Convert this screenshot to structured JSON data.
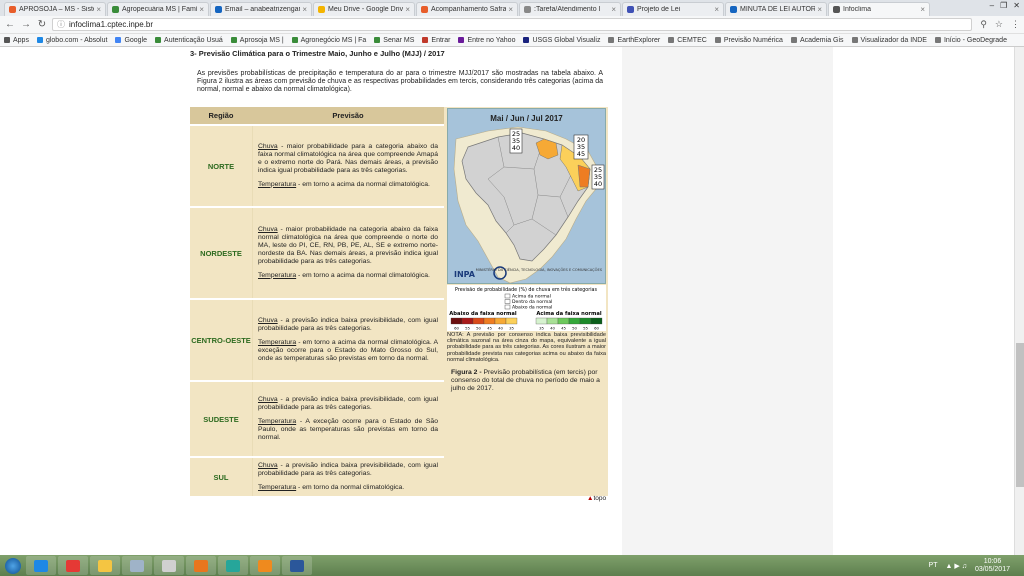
{
  "browser": {
    "tabs": [
      {
        "title": "APROSOJA – MS - Sistem",
        "color": "#e85d2a"
      },
      {
        "title": "Agropecuária MS | Famí",
        "color": "#3a8c3a"
      },
      {
        "title": "Email – anabeatrizengar",
        "color": "#1565c0"
      },
      {
        "title": "Meu Drive - Google Driv",
        "color": "#f4b400"
      },
      {
        "title": "Acompanhamento Safra",
        "color": "#e85d2a"
      },
      {
        "title": ":Tarefa/Atendimento I",
        "color": "#888888"
      },
      {
        "title": "Projeto de Lei",
        "color": "#3f51b5"
      },
      {
        "title": "MINUTA DE LEI AUTORIZ",
        "color": "#1565c0"
      },
      {
        "title": "Infoclima",
        "color": "#555555"
      }
    ],
    "url": "infoclima1.cptec.inpe.br",
    "bookmarks": [
      {
        "label": "Apps",
        "color": "#555555"
      },
      {
        "label": "globo.com - Absolut",
        "color": "#1e88e5"
      },
      {
        "label": "Google",
        "color": "#4285f4"
      },
      {
        "label": "Autenticação Usuá",
        "color": "#3a8c3a"
      },
      {
        "label": "Aprosoja MS |",
        "color": "#3a8c3a"
      },
      {
        "label": "Agronegócio MS | Fa",
        "color": "#3a8c3a"
      },
      {
        "label": "Senar MS",
        "color": "#3a8c3a"
      },
      {
        "label": "Entrar",
        "color": "#c0392b"
      },
      {
        "label": "Entre no Yahoo",
        "color": "#6a1b9a"
      },
      {
        "label": "USGS Global Visualiz",
        "color": "#1a237e"
      },
      {
        "label": "EarthExplorer",
        "color": "#777777"
      },
      {
        "label": "CEMTEC",
        "color": "#777777"
      },
      {
        "label": "Previsão Numérica",
        "color": "#777777"
      },
      {
        "label": "Academia Gis",
        "color": "#777777"
      },
      {
        "label": "Visualizador da INDE",
        "color": "#777777"
      },
      {
        "label": "Início - GeoDegrade",
        "color": "#777777"
      }
    ]
  },
  "page": {
    "section_title": "3- Previsão Climática para o Trimestre Maio, Junho e Julho (MJJ)  / 2017",
    "intro": "As previsões probabilísticas de precipitação e temperatura do ar para o trimestre MJJ/2017 são mostradas na tabela abaixo. A Figura 2 ilustra as áreas com previsão de chuva e as respectivas probabilidades em tercis, considerando três categorias (acima da normal, normal e abaixo da normal climatológica).",
    "col_region": "Região",
    "col_forecast": "Previsão",
    "rows": [
      {
        "region": "NORTE",
        "rain_label": "Chuva",
        "rain_text": " - maior probabilidade para a categoria abaixo da faixa normal climatológica na área que compreende Amapá e o extremo norte do Pará. Nas demais áreas, a previsão indica igual probabilidade para as três categorias.",
        "temp_label": "Temperatura",
        "temp_text": " - em torno a acima da normal climatológica."
      },
      {
        "region": "NORDESTE",
        "rain_label": "Chuva",
        "rain_text": " - maior probabilidade na categoria abaixo da faixa normal climatológica na área que compreende o norte do MA, leste do PI, CE, RN, PB, PE, AL, SE e extremo norte-nordeste da BA. Nas demais áreas, a previsão indica igual probabilidade para as três categorias.",
        "temp_label": "Temperatura",
        "temp_text": " - em torno a acima da normal climatológica."
      },
      {
        "region": "CENTRO-OESTE",
        "rain_label": "Chuva",
        "rain_text": " - a previsão indica baixa previsibilidade, com igual probabilidade para as três categorias.",
        "temp_label": "Temperatura",
        "temp_text": " - em torno a acima da normal climatológica. A exceção ocorre para o Estado do Mato Grosso do Sul, onde as temperaturas são previstas em torno da normal."
      },
      {
        "region": "SUDESTE",
        "rain_label": "Chuva",
        "rain_text": " - a previsão indica baixa previsibilidade, com igual probabilidade para as três categorias.",
        "temp_label": "Temperatura",
        "temp_text": " - A exceção ocorre para o Estado de São Paulo, onde as temperaturas são previstas em torno da normal."
      },
      {
        "region": "SUL",
        "rain_label": "Chuva",
        "rain_text": " - a previsão indica baixa previsibilidade, com igual probabilidade para as três categorias.",
        "temp_label": "Temperatura",
        "temp_text": " - em torno da normal climatológica."
      }
    ],
    "figure": {
      "map_title": "Mai / Jun / Jul 2017",
      "box_north": [
        "25",
        "35",
        "40"
      ],
      "box_ne_top": [
        "20",
        "35",
        "45"
      ],
      "box_ne_mid": [
        "25",
        "35",
        "40"
      ],
      "inpa_logo": "INPA",
      "ministry": "MINISTÉRIO DA CIÊNCIA, TECNOLOGIA, INOVAÇÕES E COMUNICAÇÕES",
      "legend_title": "Previsão de probabilidade (%) de chuva em três categorias",
      "legend_items": [
        "Acima da normal",
        "Dentro da normal",
        "Abaixo da normal"
      ],
      "below_label": "Abaixo da faixa normal",
      "above_label": "Acima da faixa normal",
      "below_colors": [
        "#6b0f0f",
        "#a81a1a",
        "#d94a1a",
        "#ee7d22",
        "#f6a935",
        "#fbd05a"
      ],
      "above_colors": [
        "#d6f2cf",
        "#a8e096",
        "#6cc85c",
        "#34a83a",
        "#1c8a2a",
        "#0b5e1a"
      ],
      "scale_below": [
        "60",
        "55",
        "50",
        "45",
        "40",
        "35"
      ],
      "scale_above": [
        "35",
        "40",
        "45",
        "50",
        "55",
        "60"
      ],
      "note": "NOTA: A previsão por consenso indica baixa previsibilidade climática sazonal na área cinza do mapa, equivalente a igual probabilidade para as três categorias. As cores ilustram a maior probabilidade prevista nas categorias acima ou abaixo da faixa normal climatológica.",
      "caption_bold": "Figura 2 -",
      "caption_text": " Previsão probabilística (em tercis) por consenso do total de chuva no período de maio a julho de 2017."
    },
    "top_link": "topo"
  },
  "taskbar": {
    "apps": [
      {
        "name": "internet-explorer",
        "color": "#1e88e5"
      },
      {
        "name": "chrome",
        "color": "#e53935"
      },
      {
        "name": "file-explorer",
        "color": "#f4c542"
      },
      {
        "name": "app-4",
        "color": "#9fb3c8"
      },
      {
        "name": "app-5",
        "color": "#d0d0d0"
      },
      {
        "name": "firefox",
        "color": "#e8761e"
      },
      {
        "name": "app-7",
        "color": "#26a69a"
      },
      {
        "name": "app-8",
        "color": "#ef8a1e"
      },
      {
        "name": "word",
        "color": "#2b579a"
      }
    ],
    "lang": "PT",
    "time": "10:06",
    "date": "03/05/2017"
  }
}
